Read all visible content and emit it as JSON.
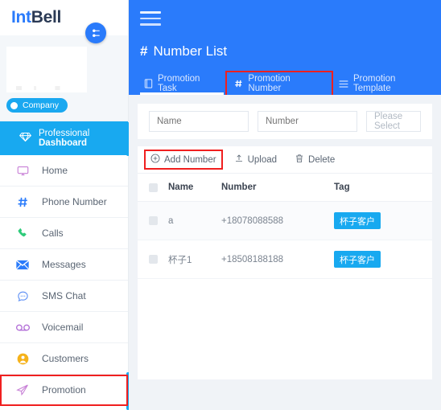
{
  "brand": {
    "part1": "Int",
    "part2": "Bell"
  },
  "sidebar": {
    "gear_icon": "gear-icon",
    "company_label": "Company",
    "dashboard": {
      "prefix": "Professional ",
      "bold": "Dashboard",
      "icon": "diamond-icon"
    },
    "items": [
      {
        "label": "Home",
        "icon": "monitor-icon",
        "color": "#c77fd6",
        "highlight": false
      },
      {
        "label": "Phone Number",
        "icon": "hash-icon",
        "color": "#2a7bfb",
        "highlight": false
      },
      {
        "label": "Calls",
        "icon": "phone-icon",
        "color": "#2ecb7a",
        "highlight": false
      },
      {
        "label": "Messages",
        "icon": "envelope-icon",
        "color": "#2a7bfb",
        "highlight": false
      },
      {
        "label": "SMS Chat",
        "icon": "chat-icon",
        "color": "#5b8ef5",
        "highlight": false
      },
      {
        "label": "Voicemail",
        "icon": "voicemail-icon",
        "color": "#b06ad6",
        "highlight": false
      },
      {
        "label": "Customers",
        "icon": "user-icon",
        "color": "#f5b21a",
        "highlight": false
      },
      {
        "label": "Promotion",
        "icon": "send-icon",
        "color": "#c77fd6",
        "highlight": true
      }
    ]
  },
  "topbar": {
    "menu_icon": "hamburger-icon",
    "title": "Number List",
    "title_icon": "hash-icon",
    "tabs": [
      {
        "label": "Promotion Task",
        "icon": "book-icon",
        "state": "active-underline"
      },
      {
        "label": "Promotion Number",
        "icon": "hash-icon",
        "state": "boxed"
      },
      {
        "label": "Promotion Template",
        "icon": "list-icon",
        "state": "plain"
      }
    ]
  },
  "filters": {
    "name_placeholder": "Name",
    "number_placeholder": "Number",
    "select_placeholder": "Please Select"
  },
  "toolbar": {
    "add_label": "Add Number",
    "add_icon": "plus-circle-icon",
    "upload_label": "Upload",
    "upload_icon": "upload-icon",
    "delete_label": "Delete",
    "delete_icon": "trash-icon"
  },
  "table": {
    "headers": [
      "",
      "Name",
      "Number",
      "Tag"
    ],
    "rows": [
      {
        "name": "a",
        "number": "+18078088588",
        "tag": "杯子客户"
      },
      {
        "name": "杯子1",
        "number": "+18508188188",
        "tag": "杯子客户"
      }
    ]
  },
  "colors": {
    "header_blue": "#2a7bfb",
    "accent_cyan": "#18a9f0",
    "highlight_red": "#f01f1f",
    "page_bg": "#f0f3f7"
  }
}
